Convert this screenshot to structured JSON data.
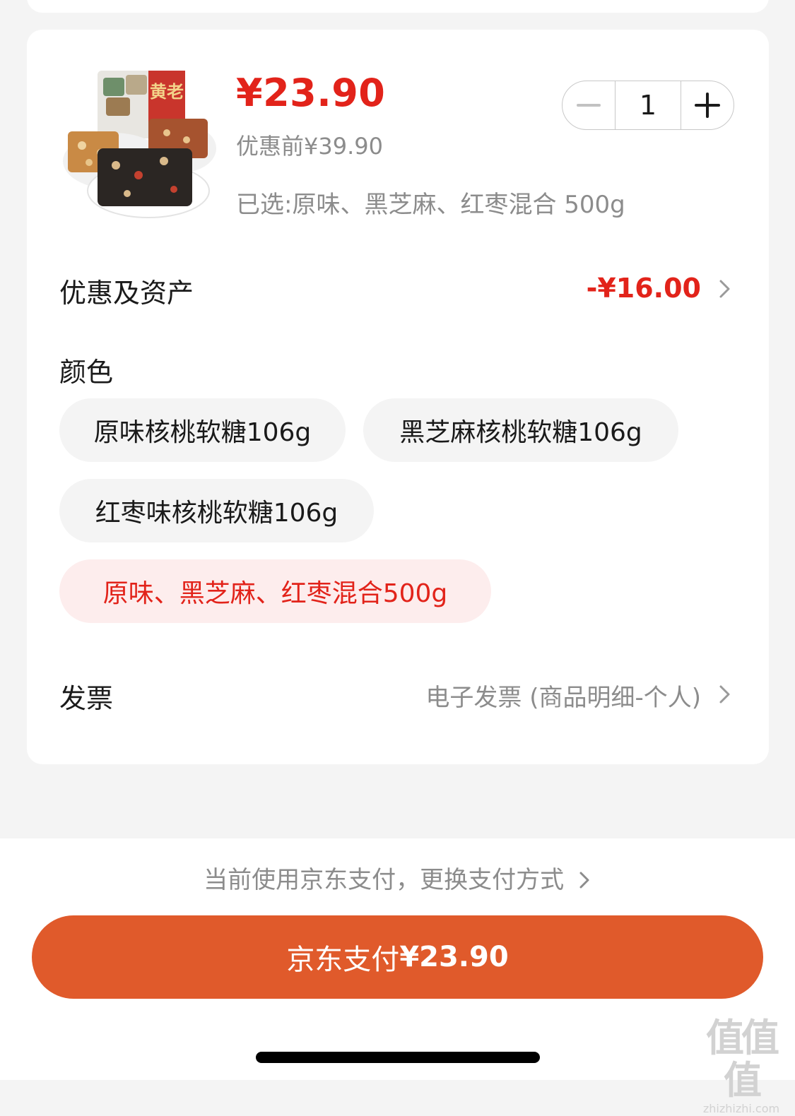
{
  "product": {
    "price": "¥23.90",
    "original_price": "优惠前¥39.90",
    "selected_spec": "已选:原味、黑芝麻、红枣混合 500g",
    "image_icon": "walnut-candy-product-image",
    "image_brand_text": "黄老"
  },
  "quantity": {
    "value": "1",
    "decrease_icon": "minus-icon",
    "increase_icon": "plus-icon"
  },
  "discount": {
    "label": "优惠及资产",
    "value": "-¥16.00"
  },
  "color": {
    "label": "颜色",
    "options": [
      {
        "label": "原味核桃软糖106g",
        "selected": false
      },
      {
        "label": "黑芝麻核桃软糖106g",
        "selected": false
      },
      {
        "label": "红枣味核桃软糖106g",
        "selected": false
      },
      {
        "label": "原味、黑芝麻、红枣混合500g",
        "selected": true
      }
    ]
  },
  "invoice": {
    "label": "发票",
    "value": "电子发票 (商品明细-个人)"
  },
  "payment": {
    "hint": "当前使用京东支付，更换支付方式",
    "button_label": "京东支付",
    "button_amount": "¥23.90"
  },
  "watermark": {
    "logo": "值值值",
    "url": "zhizhizhi.com"
  },
  "colors": {
    "accent_red": "#e2231a",
    "pay_button": "#e05a2b",
    "selected_chip_bg": "#fdeded",
    "chip_bg": "#f4f4f4",
    "muted_text": "#8c8c8c"
  }
}
